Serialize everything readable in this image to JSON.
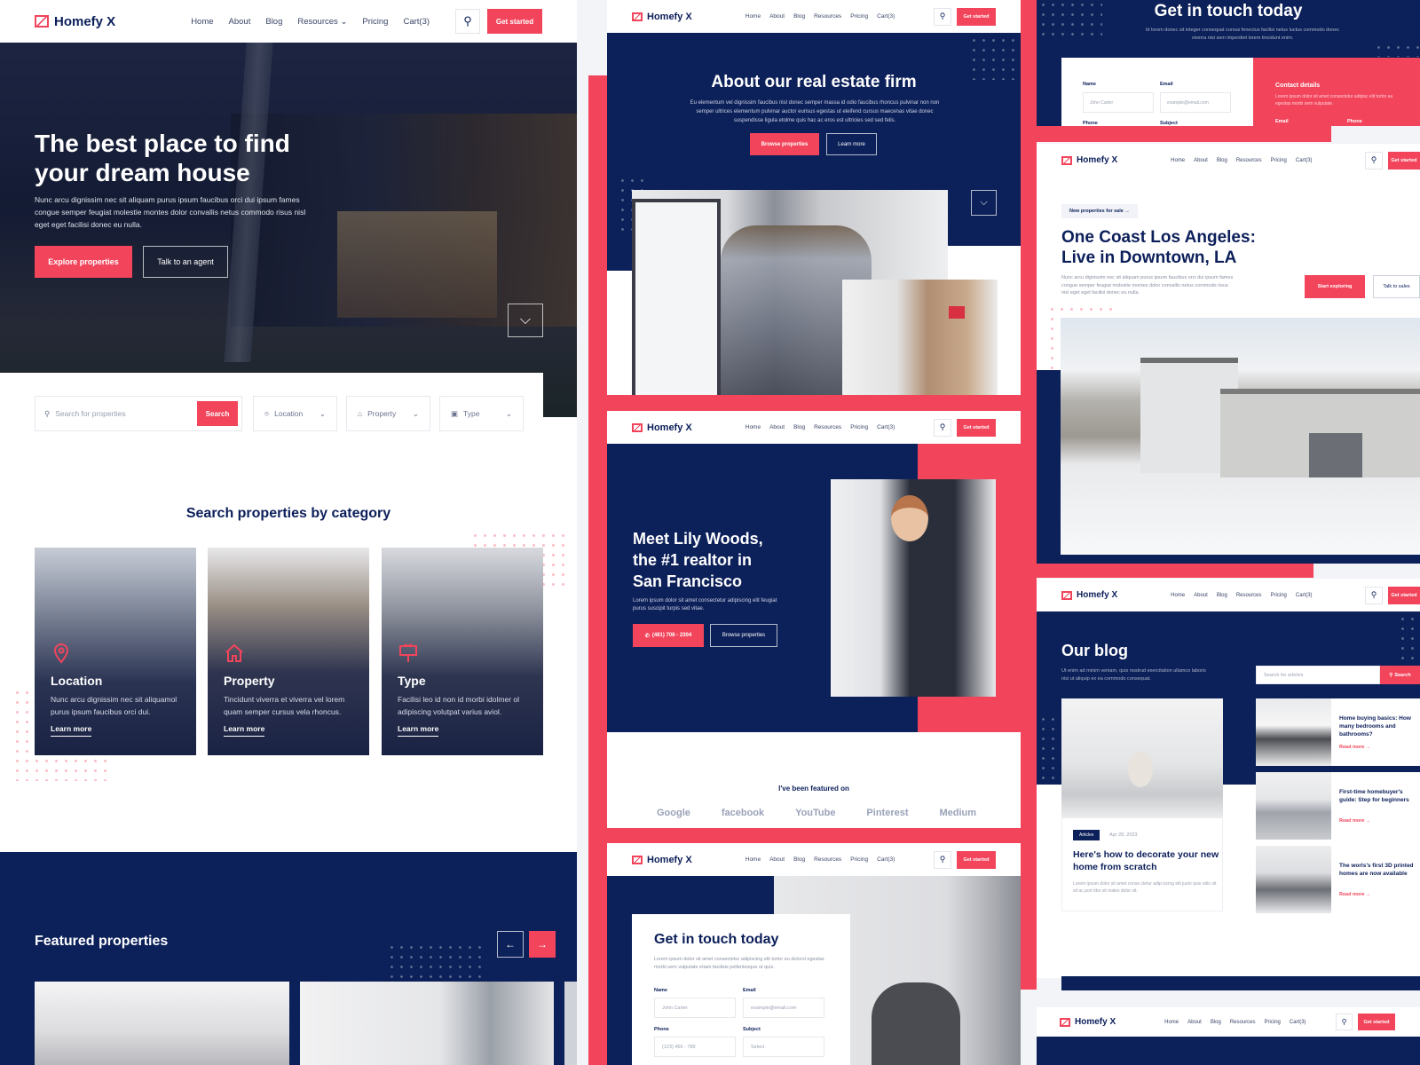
{
  "brand": {
    "name": "Homefy X",
    "accent": "#f2455c",
    "navy": "#0c2059"
  },
  "nav": {
    "items": [
      "Home",
      "About",
      "Blog",
      "Resources",
      "Pricing",
      "Cart(3)"
    ],
    "cta": "Get started"
  },
  "home": {
    "hero_title_1": "The best place to find",
    "hero_title_2": "your dream house",
    "hero_text": "Nunc arcu dignissim nec sit aliquam purus ipsum faucibus orci dui ipsum fames congue semper feugiat molestie montes dolor convallis netus commodo risus nisl eget eget facilisi donec eu nulla.",
    "btn_primary": "Explore properties",
    "btn_secondary": "Talk to an agent",
    "search": {
      "placeholder": "Search for properties",
      "button": "Search",
      "location": "Location",
      "property": "Property",
      "type": "Type"
    },
    "category_title": "Search properties by category",
    "categories": [
      {
        "title": "Location",
        "desc": "Nunc arcu dignissim nec sit aliquamol purus ipsum faucibus orci dui.",
        "link": "Learn more"
      },
      {
        "title": "Property",
        "desc": "Tincidunt viverra et viverra vel lorem quam semper cursus vela rhoncus.",
        "link": "Learn more"
      },
      {
        "title": "Type",
        "desc": "Facilisi leo id non id morbi idolmer ol adipiscing volutpat varius aviol.",
        "link": "Learn more"
      }
    ],
    "featured_title": "Featured properties"
  },
  "about": {
    "title": "About our real estate firm",
    "text": "Eu elementum vel dignissim faucibus nisl donec semper massa id odio faucibus rhoncus pulvinar non non semper ultrices elementum pulvinar auctor eurisus egestas ut eleifend cursus maecenas vitae donec suspendisse ligula etolme quis hac ac eros est ultricies sed sed felis.",
    "btn_primary": "Browse properties",
    "btn_secondary": "Learn more"
  },
  "agent": {
    "title_1": "Meet Lily Woods,",
    "title_2": "the #1 realtor in",
    "title_3": "San Francisco",
    "text": "Lorem ipsum dolor sit amet consectetur adipiscing elit feugiat purus suscipit turpis sed vitae.",
    "phone": "(481) 708 - 2304",
    "btn_secondary": "Browse properties",
    "featured_label": "I've been featured on",
    "featured_logos": [
      "Google",
      "facebook",
      "YouTube",
      "Pinterest",
      "Medium"
    ]
  },
  "contact": {
    "title": "Get in touch today",
    "text": "Lorem ipsum dolor sit amet consectetur adipiscing elit tortor eu dolorol egestas morbi sem vulputate etiam facilisis pellentesque ut quis.",
    "name_label": "Name",
    "name_placeholder": "John Carter",
    "email_label": "Email",
    "email_placeholder": "example@email.com",
    "phone_label": "Phone",
    "phone_placeholder": "(123) 456 - 789",
    "subject_label": "Subject",
    "subject_placeholder": "Select"
  },
  "contact2": {
    "title": "Get in touch today",
    "text": "Id lorem donec sit integer consequat cursus fenectus facilisi netus luctus commodo donec viverra nisi sem imperdiet lorem tincidunt enim.",
    "name_label": "Name",
    "name_placeholder": "John Carter",
    "email_label": "Email",
    "email_placeholder": "example@email.com",
    "phone_label": "Phone",
    "subject_label": "Subject",
    "details_title": "Contact details",
    "details_text": "Lorem ipsum dolor sit amet consectetur adipisc elit tortor eu egestas morbi sem vulputate.",
    "details_email": "Email",
    "details_phone": "Phone"
  },
  "listing": {
    "badge": "New properties for sale →",
    "title_1": "One Coast Los Angeles:",
    "title_2": "Live in Downtown, LA",
    "text": "Nunc arcu dignissim nec sit aliquam purus ipsum faucibus orci dui ipsum fames congue semper feugiat molestie montes dolor convallis netus commodo risus nisl eget eget facilisi donec eu nulla.",
    "btn_primary": "Start exploring",
    "btn_secondary": "Talk to sales"
  },
  "blog": {
    "title": "Our blog",
    "text": "Ut enim ad minim veniam, quis nostrud exercitation ullamco laboris nisi ut aliquip ex ea commodo consequat.",
    "search_placeholder": "Search for articles",
    "search_button": "Search",
    "main_post": {
      "tag": "Articles",
      "date": "Apr 28, 2023",
      "title": "Here's how to decorate your new home from scratch",
      "excerpt": "Lorem ipsum dolor sit amet conse ctetur adip iscing elit justo quis odio sit sit ac port titor sit males dolor sit."
    },
    "posts": [
      {
        "title": "Home buying basics: How many bedrooms and bathrooms?",
        "link": "Read more →"
      },
      {
        "title": "First-time homebuyer's guide: Step for beginners",
        "link": "Read more →"
      },
      {
        "title": "The worls's first 3D printed homes are now available",
        "link": "Read more →"
      }
    ]
  }
}
